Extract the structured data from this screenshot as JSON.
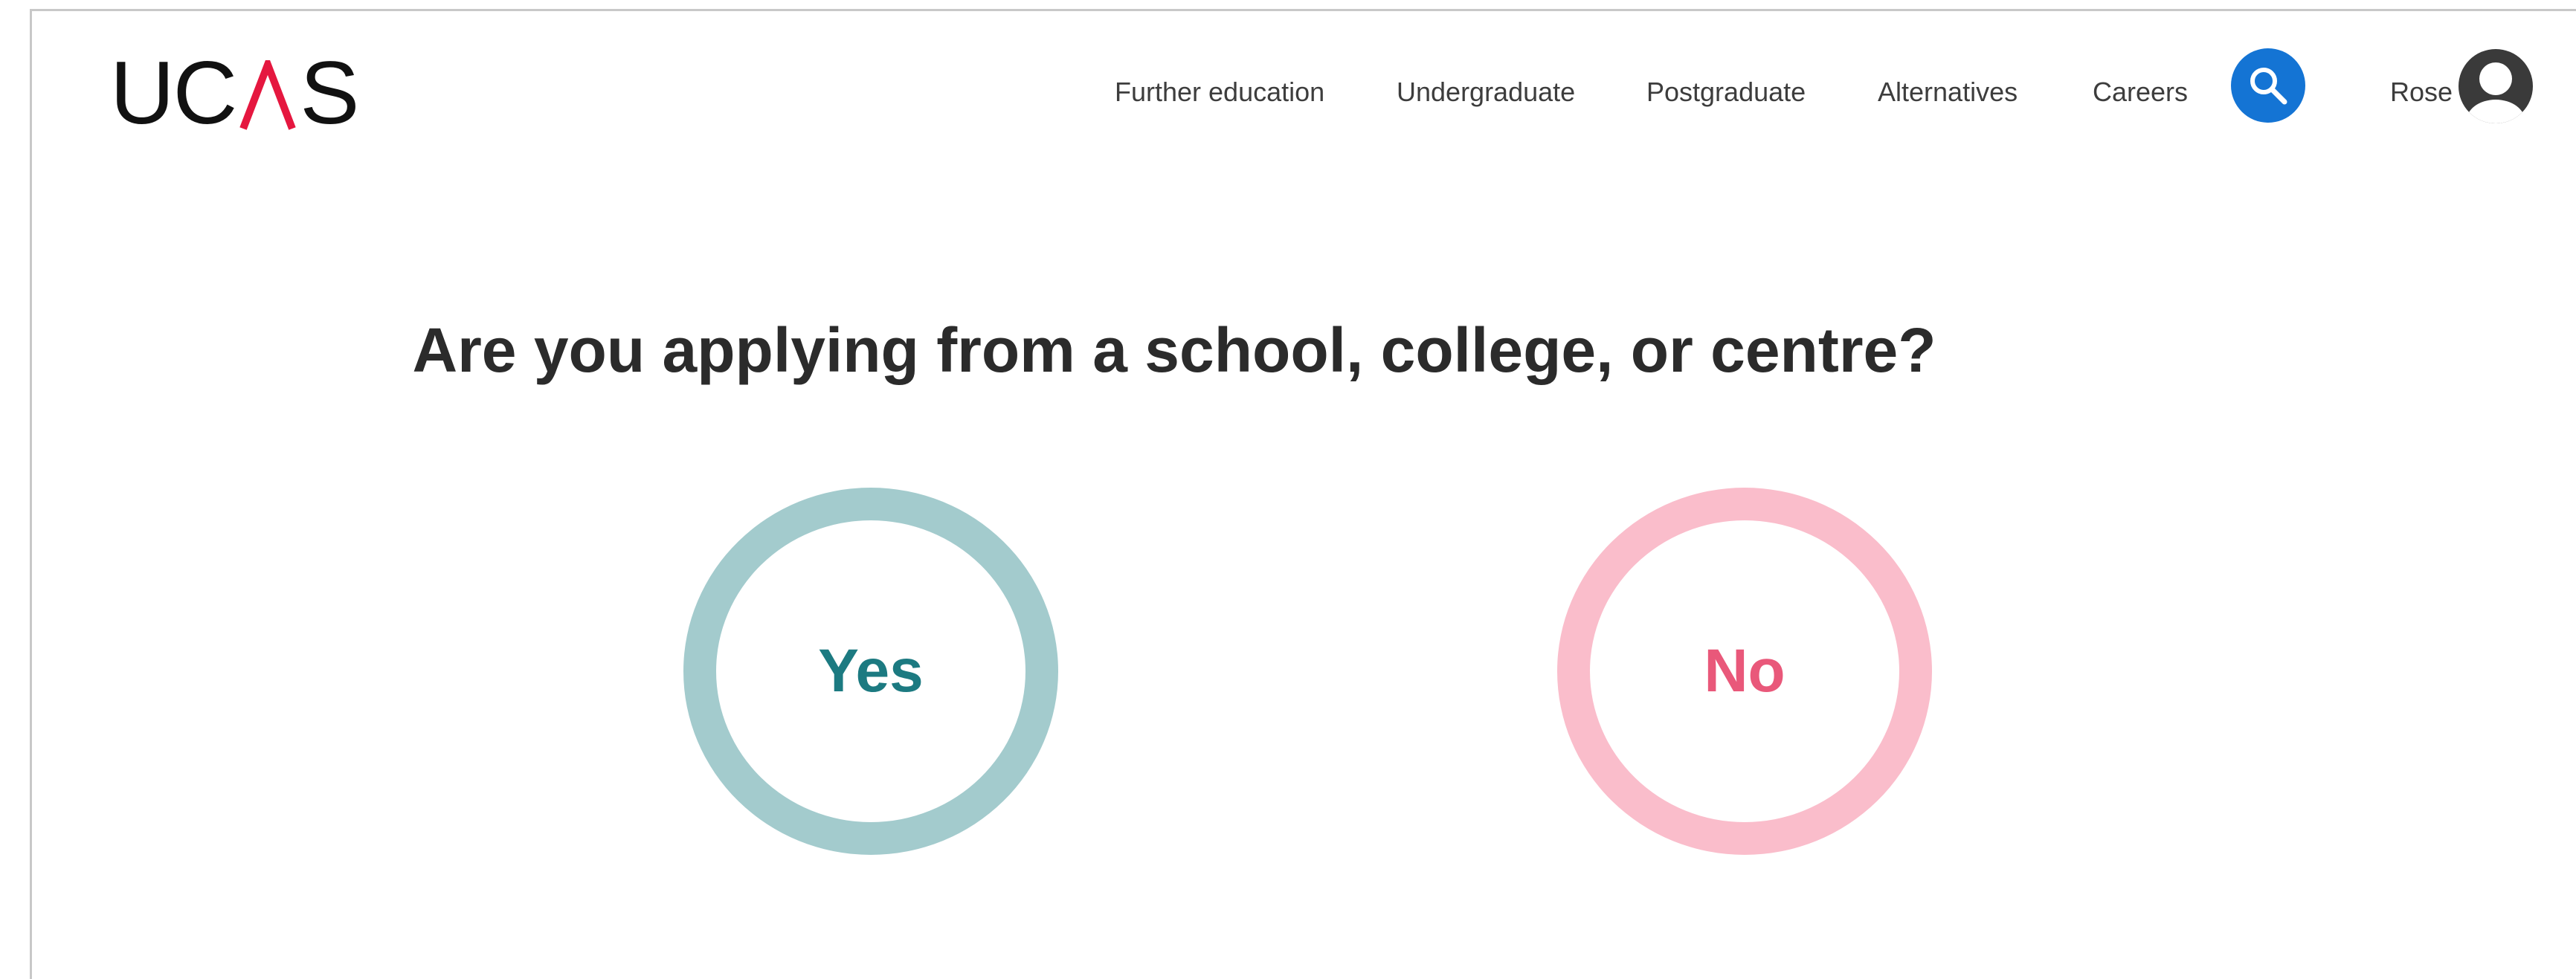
{
  "header": {
    "logo": {
      "letters": [
        "U",
        "C",
        "S"
      ],
      "accent_color": "#e5173f"
    },
    "nav_links": [
      {
        "label": "Further education"
      },
      {
        "label": "Undergraduate"
      },
      {
        "label": "Postgraduate"
      },
      {
        "label": "Alternatives"
      },
      {
        "label": "Careers"
      }
    ],
    "search": {
      "icon": "search-icon",
      "color": "#1474d4"
    },
    "user": {
      "name": "Rose",
      "icon": "user-avatar-icon"
    }
  },
  "main": {
    "question": "Are you applying from a school, college, or centre?",
    "options": [
      {
        "label": "Yes",
        "ring_color": "#a3cbcd",
        "text_color": "#1c7a81"
      },
      {
        "label": "No",
        "ring_color": "#fabdcb",
        "text_color": "#e9587a"
      }
    ]
  }
}
